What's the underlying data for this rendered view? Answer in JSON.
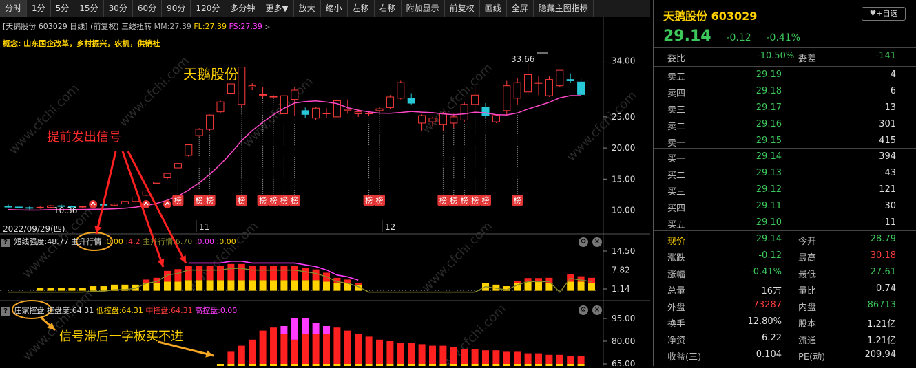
{
  "toolbar": {
    "items": [
      "分时",
      "1分",
      "5分",
      "15分",
      "30分",
      "60分",
      "90分",
      "120分",
      "多分钟",
      "更多▼",
      "放大",
      "缩小",
      "左移",
      "右移",
      "附加显示",
      "前复权",
      "画线",
      "全屏",
      "隐藏主图指标"
    ]
  },
  "main_chart": {
    "info": {
      "name": "[天鹅股份 603029 日线]",
      "adjust": "(前复权)",
      "indicator": "三线扭转",
      "mm": "MM:27.39",
      "fl": "FL:27.39",
      "fs": "FS:27.39",
      "dots": ":-"
    },
    "concept": "概念: 山东国企改革，乡村振兴，农机，供销社",
    "stock_annotation": "天鹅股份",
    "signal_annotation": "提前发出信号",
    "high_label": "33.66",
    "low_label": "10.36",
    "bang_label": "榜",
    "date_label": "2022/09/29(四)",
    "month_labels": [
      "11",
      "12"
    ],
    "y_ticks": [
      "34.00",
      "25.00",
      "20.00",
      "15.00",
      "10.00"
    ]
  },
  "panel1": {
    "question": "?",
    "label_short": "短线强度:48.77",
    "label_main": "主升行情",
    "v1": ":0.00",
    "v2": ":4.2",
    "label_main2": "主升行情:6.70",
    "v3": ":0.00",
    "v4": ":0.00",
    "y_ticks": [
      "14.50",
      "7.82",
      "1.14"
    ]
  },
  "panel2": {
    "question": "?",
    "label": "庄家控盘",
    "c1": "控盘度:64.31",
    "c2": "低控盘:64.31",
    "c3": "中控盘:64.31",
    "c4": "高控盘:0.00",
    "annotation": "信号滞后一字板买不进",
    "y_ticks": [
      "95.00",
      "80.00",
      "65.00"
    ]
  },
  "quote": {
    "name": "天鹅股份",
    "code": "603029",
    "fav_label": "+自选",
    "price": "29.14",
    "change": "-0.12",
    "pct": "-0.41%",
    "weibi_label": "委比",
    "weibi": "-10.50%",
    "weicha_label": "委差",
    "weicha": "-141",
    "asks": [
      {
        "label": "卖五",
        "price": "29.19",
        "vol": "4"
      },
      {
        "label": "卖四",
        "price": "29.18",
        "vol": "6"
      },
      {
        "label": "卖三",
        "price": "29.17",
        "vol": "13"
      },
      {
        "label": "卖二",
        "price": "29.16",
        "vol": "301"
      },
      {
        "label": "卖一",
        "price": "29.15",
        "vol": "415"
      }
    ],
    "bids": [
      {
        "label": "买一",
        "price": "29.14",
        "vol": "394"
      },
      {
        "label": "买二",
        "price": "29.13",
        "vol": "43"
      },
      {
        "label": "买三",
        "price": "29.12",
        "vol": "121"
      },
      {
        "label": "买四",
        "price": "29.11",
        "vol": "30"
      },
      {
        "label": "买五",
        "price": "29.10",
        "vol": "11"
      }
    ],
    "stats": [
      {
        "l1": "现价",
        "v1": "29.14",
        "l2": "今开",
        "v2": "28.79"
      },
      {
        "l1": "涨跌",
        "v1": "-0.12",
        "l2": "最高",
        "v2": "30.18"
      },
      {
        "l1": "涨幅",
        "v1": "-0.41%",
        "l2": "最低",
        "v2": "27.61"
      },
      {
        "l1": "总量",
        "v1": "16万",
        "l2": "量比",
        "v2": "0.74"
      },
      {
        "l1": "外盘",
        "v1": "73287",
        "l2": "内盘",
        "v2": "86713"
      },
      {
        "l1": "换手",
        "v1": "12.80%",
        "l2": "股本",
        "v2": "1.21亿"
      },
      {
        "l1": "净资",
        "v1": "6.22",
        "l2": "流通",
        "v2": "1.21亿"
      },
      {
        "l1": "收益(三)",
        "v1": "0.104",
        "l2": "PE(动)",
        "v2": "209.94"
      }
    ]
  },
  "colors": {
    "up": "#ff3c3c",
    "down": "#28c8d8",
    "green": "#3cc85a",
    "yellow": "#ffd200",
    "magenta": "#ff3cff",
    "pink": "#ff48c8",
    "orange": "#f5a623"
  },
  "candles": [
    [
      10.6,
      10.9,
      10.3,
      10.5
    ],
    [
      10.5,
      10.7,
      10.2,
      10.4
    ],
    [
      10.4,
      10.6,
      10.1,
      10.35
    ],
    [
      10.35,
      10.6,
      10.2,
      10.45
    ],
    [
      10.45,
      10.8,
      10.4,
      10.7
    ],
    [
      10.7,
      10.9,
      10.5,
      10.6
    ],
    [
      10.6,
      10.8,
      10.4,
      10.5
    ],
    [
      10.5,
      10.7,
      10.3,
      10.6
    ],
    [
      10.6,
      11.0,
      10.5,
      10.9
    ],
    [
      10.9,
      11.2,
      10.7,
      10.8
    ],
    [
      10.8,
      11.1,
      10.6,
      11.0
    ],
    [
      11.0,
      11.5,
      10.9,
      11.4
    ],
    [
      11.4,
      12.2,
      11.3,
      12.1
    ],
    [
      12.4,
      13.2,
      12.3,
      13.1
    ],
    [
      14.3,
      14.5,
      14.2,
      14.5
    ],
    [
      15.2,
      16.0,
      15.0,
      15.9
    ],
    [
      16.8,
      17.6,
      16.7,
      17.5
    ],
    [
      18.8,
      20.6,
      18.6,
      20.5
    ],
    [
      22.0,
      23.2,
      21.8,
      23.0
    ],
    [
      23.0,
      25.4,
      22.8,
      25.3
    ],
    [
      25.8,
      27.6,
      25.6,
      27.4
    ],
    [
      28.8,
      30.5,
      28.5,
      30.3
    ],
    [
      27.0,
      33.0,
      26.5,
      33.0
    ],
    [
      29.8,
      30.4,
      29.3,
      30.0
    ],
    [
      28.5,
      29.8,
      28.0,
      28.6
    ],
    [
      28.2,
      28.5,
      28.0,
      28.3
    ],
    [
      25.5,
      28.6,
      25.2,
      28.4
    ],
    [
      27.8,
      29.8,
      25.2,
      29.3
    ],
    [
      26.0,
      26.5,
      24.8,
      25.4
    ],
    [
      24.8,
      26.6,
      24.5,
      26.4
    ],
    [
      25.5,
      26.4,
      24.8,
      25.6
    ],
    [
      25.0,
      27.9,
      24.8,
      27.6
    ],
    [
      26.0,
      27.8,
      25.5,
      26.2
    ],
    [
      25.5,
      26.2,
      25.0,
      25.8
    ],
    [
      25.6,
      26.0,
      25.2,
      25.6
    ],
    [
      26.0,
      26.6,
      25.8,
      26.3
    ],
    [
      26.5,
      28.5,
      26.2,
      28.2
    ],
    [
      28.0,
      30.8,
      27.8,
      30.5
    ],
    [
      28.0,
      28.8,
      27.0,
      27.2
    ],
    [
      24.0,
      25.4,
      22.8,
      25.2
    ],
    [
      24.2,
      25.0,
      23.5,
      24.8
    ],
    [
      23.8,
      25.8,
      22.8,
      25.5
    ],
    [
      24.0,
      25.5,
      23.2,
      25.0
    ],
    [
      24.5,
      27.4,
      24.2,
      27.0
    ],
    [
      27.0,
      30.0,
      26.0,
      28.5
    ],
    [
      26.5,
      27.2,
      24.8,
      25.2
    ],
    [
      24.2,
      25.4,
      24.0,
      25.2
    ],
    [
      26.0,
      30.8,
      25.2,
      30.0
    ],
    [
      28.0,
      31.2,
      27.0,
      30.5
    ],
    [
      29.0,
      33.6,
      28.5,
      31.8
    ],
    [
      30.5,
      31.5,
      28.5,
      30.5
    ],
    [
      28.4,
      31.5,
      28.2,
      31.0
    ],
    [
      30.0,
      32.5,
      29.8,
      32.5
    ],
    [
      31.0,
      32.0,
      30.5,
      30.8
    ],
    [
      30.6,
      31.2,
      28.2,
      28.6
    ]
  ],
  "bang_idx": [
    16,
    18,
    19,
    22,
    24,
    25,
    26,
    27,
    34,
    35,
    41,
    42,
    43,
    44,
    45,
    48
  ],
  "p1_bars": [
    [
      0,
      0
    ],
    [
      0,
      0
    ],
    [
      0,
      0
    ],
    [
      2,
      0
    ],
    [
      2,
      0
    ],
    [
      2,
      0
    ],
    [
      2,
      0
    ],
    [
      2,
      0
    ],
    [
      3,
      0
    ],
    [
      3,
      0
    ],
    [
      4,
      0
    ],
    [
      4,
      0
    ],
    [
      4,
      0
    ],
    [
      5,
      2
    ],
    [
      5,
      3
    ],
    [
      6,
      6
    ],
    [
      6,
      7
    ],
    [
      7,
      8
    ],
    [
      7,
      8
    ],
    [
      7,
      8
    ],
    [
      7,
      8
    ],
    [
      7,
      9
    ],
    [
      7,
      9
    ],
    [
      7,
      8
    ],
    [
      7,
      8
    ],
    [
      7,
      8
    ],
    [
      7,
      8
    ],
    [
      7,
      8
    ],
    [
      7,
      7
    ],
    [
      7,
      6
    ],
    [
      6,
      5
    ],
    [
      5,
      3
    ],
    [
      5,
      2
    ],
    [
      4,
      1
    ],
    [
      0,
      0
    ],
    [
      0,
      0
    ],
    [
      0,
      0
    ],
    [
      0,
      0
    ],
    [
      0,
      0
    ],
    [
      0,
      0
    ],
    [
      0,
      0
    ],
    [
      0,
      0
    ],
    [
      0,
      0
    ],
    [
      0,
      0
    ],
    [
      0,
      0
    ],
    [
      5,
      0
    ],
    [
      4,
      0
    ],
    [
      3,
      0
    ],
    [
      5,
      1
    ],
    [
      6,
      2
    ],
    [
      6,
      2
    ],
    [
      5,
      3
    ],
    [
      0,
      0
    ],
    [
      6,
      4
    ],
    [
      6,
      3
    ],
    [
      5,
      3
    ]
  ],
  "p2_bars": [
    [
      0,
      0,
      0
    ],
    [
      0,
      0,
      0
    ],
    [
      0,
      0,
      0
    ],
    [
      0,
      0,
      0
    ],
    [
      0,
      0,
      0
    ],
    [
      0,
      0,
      0
    ],
    [
      0,
      0,
      0
    ],
    [
      0,
      0,
      0
    ],
    [
      0,
      0,
      0
    ],
    [
      0,
      0,
      0
    ],
    [
      0,
      0,
      0
    ],
    [
      0,
      0,
      0
    ],
    [
      0,
      0,
      0
    ],
    [
      0,
      0,
      0
    ],
    [
      0,
      0,
      0
    ],
    [
      0,
      0,
      0
    ],
    [
      0,
      0,
      0
    ],
    [
      0,
      0,
      0
    ],
    [
      0,
      0,
      0
    ],
    [
      0,
      0,
      0
    ],
    [
      65,
      0,
      0
    ],
    [
      65,
      8,
      0
    ],
    [
      65,
      12,
      0
    ],
    [
      65,
      16,
      0
    ],
    [
      65,
      22,
      0
    ],
    [
      65,
      24,
      0
    ],
    [
      65,
      20,
      5
    ],
    [
      65,
      16,
      14
    ],
    [
      65,
      20,
      10
    ],
    [
      65,
      20,
      7
    ],
    [
      65,
      20,
      5
    ],
    [
      65,
      24,
      0
    ],
    [
      65,
      22,
      0
    ],
    [
      65,
      20,
      0
    ],
    [
      65,
      18,
      0
    ],
    [
      65,
      16,
      0
    ],
    [
      65,
      15,
      0
    ],
    [
      65,
      14,
      0
    ],
    [
      65,
      14,
      0
    ],
    [
      65,
      13,
      0
    ],
    [
      65,
      12,
      0
    ],
    [
      65,
      12,
      0
    ],
    [
      65,
      11,
      0
    ],
    [
      65,
      10,
      0
    ],
    [
      65,
      10,
      0
    ],
    [
      65,
      9,
      0
    ],
    [
      65,
      9,
      0
    ],
    [
      65,
      8,
      0
    ],
    [
      65,
      8,
      0
    ],
    [
      65,
      7,
      0
    ],
    [
      65,
      7,
      0
    ],
    [
      65,
      6,
      0
    ],
    [
      65,
      6,
      0
    ],
    [
      65,
      5,
      0
    ],
    [
      65,
      5,
      0
    ]
  ]
}
